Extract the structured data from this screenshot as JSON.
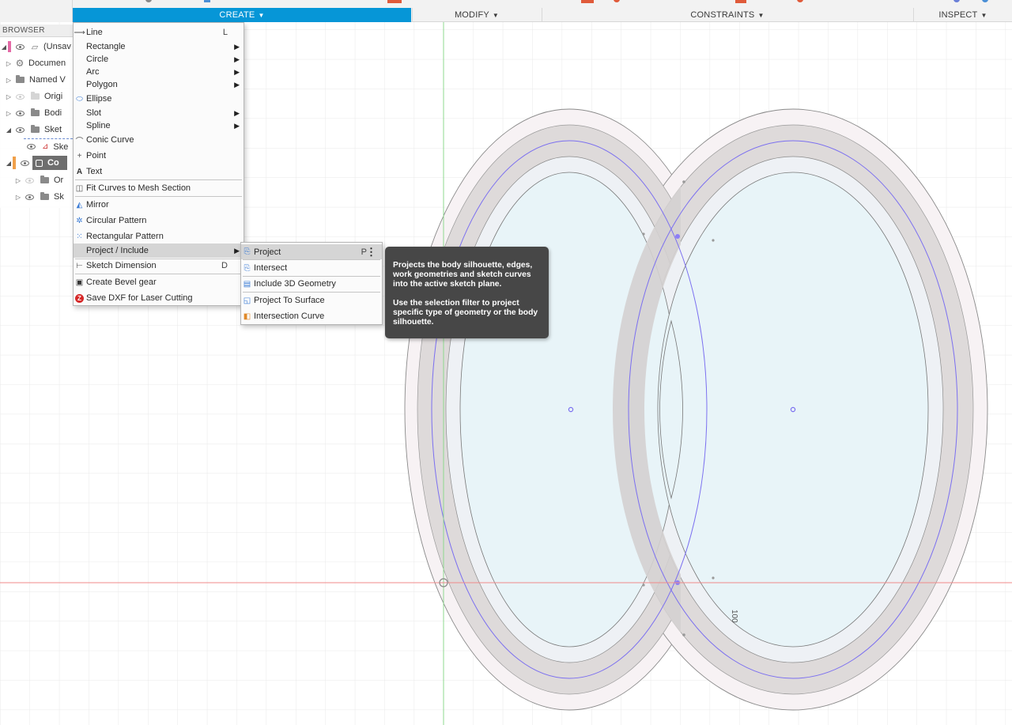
{
  "toolbar": {
    "sections": [
      {
        "label": "CREATE",
        "active": true
      },
      {
        "label": "MODIFY",
        "active": false
      },
      {
        "label": "CONSTRAINTS",
        "active": false
      },
      {
        "label": "INSPECT",
        "active": false
      }
    ],
    "accent_color": "#0696d7"
  },
  "browser": {
    "title": "BROWSER",
    "items": [
      {
        "label": "(Unsav"
      },
      {
        "label": "Documen"
      },
      {
        "label": "Named V"
      },
      {
        "label": "Origi"
      },
      {
        "label": "Bodi"
      },
      {
        "label": "Sket"
      },
      {
        "label": "Ske"
      },
      {
        "label": "Co"
      },
      {
        "label": "Or"
      },
      {
        "label": "Sk"
      }
    ]
  },
  "create_menu": {
    "items": [
      {
        "label": "Line",
        "shortcut": "L",
        "icon": "line-icon"
      },
      {
        "label": "Rectangle",
        "submenu": true
      },
      {
        "label": "Circle",
        "submenu": true
      },
      {
        "label": "Arc",
        "submenu": true
      },
      {
        "label": "Polygon",
        "submenu": true
      },
      {
        "label": "Ellipse",
        "icon": "ellipse-icon"
      },
      {
        "label": "Slot",
        "submenu": true
      },
      {
        "label": "Spline",
        "submenu": true
      },
      {
        "label": "Conic Curve",
        "icon": "conic-curve-icon"
      },
      {
        "label": "Point",
        "icon": "point-icon"
      },
      {
        "label": "Text",
        "icon": "text-icon"
      },
      {
        "label": "Fit Curves to Mesh Section",
        "icon": "mesh-section-icon"
      },
      {
        "label": "Mirror",
        "icon": "mirror-icon"
      },
      {
        "label": "Circular Pattern",
        "icon": "circular-pattern-icon"
      },
      {
        "label": "Rectangular Pattern",
        "icon": "rectangular-pattern-icon"
      },
      {
        "label": "Project / Include",
        "submenu": true,
        "highlighted": true
      },
      {
        "label": "Sketch Dimension",
        "shortcut": "D",
        "icon": "dimension-icon"
      },
      {
        "label": "Create Bevel gear",
        "icon": "bevel-gear-icon"
      },
      {
        "label": "Save DXF for Laser Cutting",
        "icon": "dxf-icon"
      }
    ]
  },
  "project_submenu": {
    "items": [
      {
        "label": "Project",
        "shortcut": "P",
        "highlighted": true,
        "icon": "project-icon"
      },
      {
        "label": "Intersect",
        "icon": "intersect-icon"
      },
      {
        "label": "Include 3D Geometry",
        "icon": "include-3d-geometry-icon"
      },
      {
        "label": "Project To Surface",
        "icon": "project-to-surface-icon"
      },
      {
        "label": "Intersection Curve",
        "icon": "intersection-curve-icon"
      }
    ]
  },
  "tooltip": {
    "paragraph1": "Projects the body silhouette, edges, work geometries and sketch curves into the active sketch plane.",
    "paragraph2": "Use the selection filter to project specific type of geometry or the body silhouette."
  },
  "canvas": {
    "dimension_label": "100"
  }
}
